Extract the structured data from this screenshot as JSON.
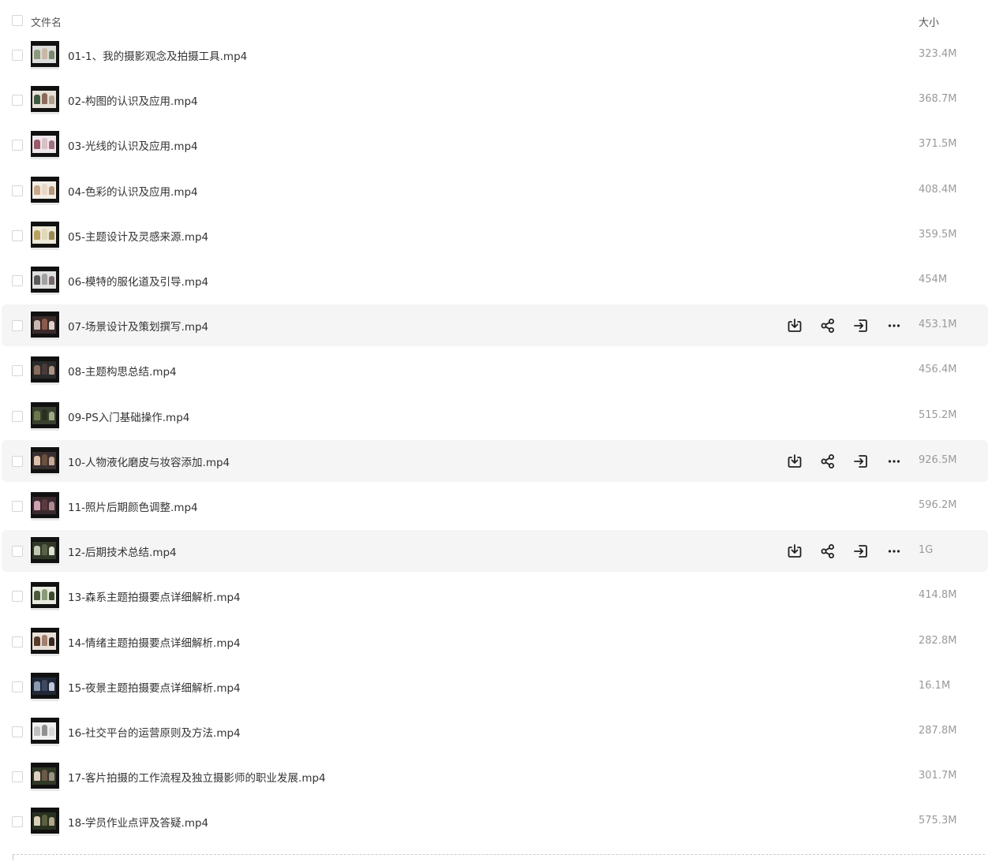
{
  "header": {
    "name_label": "文件名",
    "size_label": "大小"
  },
  "files": [
    {
      "name": "01-1、我的摄影观念及拍摄工具.mp4",
      "size": "323.4M",
      "hover": false
    },
    {
      "name": "02-构图的认识及应用.mp4",
      "size": "368.7M",
      "hover": false
    },
    {
      "name": "03-光线的认识及应用.mp4",
      "size": "371.5M",
      "hover": false
    },
    {
      "name": "04-色彩的认识及应用.mp4",
      "size": "408.4M",
      "hover": false
    },
    {
      "name": "05-主题设计及灵感来源.mp4",
      "size": "359.5M",
      "hover": false
    },
    {
      "name": "06-模特的服化道及引导.mp4",
      "size": "454M",
      "hover": false
    },
    {
      "name": "07-场景设计及策划撰写.mp4",
      "size": "453.1M",
      "hover": true
    },
    {
      "name": "08-主题构思总结.mp4",
      "size": "456.4M",
      "hover": false
    },
    {
      "name": "09-PS入门基础操作.mp4",
      "size": "515.2M",
      "hover": false
    },
    {
      "name": "10-人物液化磨皮与妆容添加.mp4",
      "size": "926.5M",
      "hover": true
    },
    {
      "name": "11-照片后期颜色调整.mp4",
      "size": "596.2M",
      "hover": false
    },
    {
      "name": "12-后期技术总结.mp4",
      "size": "1G",
      "hover": true
    },
    {
      "name": "13-森系主题拍摄要点详细解析.mp4",
      "size": "414.8M",
      "hover": false
    },
    {
      "name": "14-情绪主题拍摄要点详细解析.mp4",
      "size": "282.8M",
      "hover": false
    },
    {
      "name": "15-夜景主题拍摄要点详细解析.mp4",
      "size": "16.1M",
      "hover": false
    },
    {
      "name": "16-社交平台的运营原则及方法.mp4",
      "size": "287.8M",
      "hover": false
    },
    {
      "name": "17-客片拍摄的工作流程及独立摄影师的职业发展.mp4",
      "size": "301.7M",
      "hover": false
    },
    {
      "name": "18-学员作业点评及答疑.mp4",
      "size": "575.3M",
      "hover": false
    }
  ],
  "row_actions": [
    "download-icon",
    "share-icon",
    "move-icon",
    "more-icon"
  ],
  "colors": {
    "hover_row_bg": "#f5f5f6",
    "text": "#333333",
    "muted_text": "#9a9a9a",
    "icon": "#222222"
  }
}
